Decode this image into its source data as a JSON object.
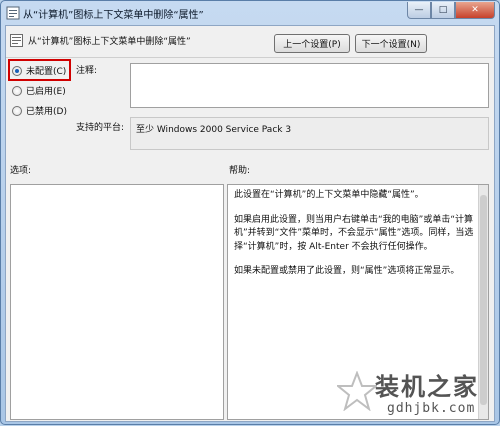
{
  "window": {
    "title": "从“计算机”图标上下文菜单中删除“属性”",
    "minimize_glyph": "—",
    "maximize_glyph": "□",
    "close_glyph": "✕"
  },
  "policy": {
    "icon": "policy-setting-icon",
    "title": "从“计算机”图标上下文菜单中删除“属性”"
  },
  "buttons": {
    "prev": "上一个设置(P)",
    "next": "下一个设置(N)"
  },
  "state": {
    "options": [
      {
        "label": "未配置(C)",
        "checked": true
      },
      {
        "label": "已启用(E)",
        "checked": false
      },
      {
        "label": "已禁用(D)",
        "checked": false
      }
    ]
  },
  "comment": {
    "label": "注释:",
    "value": ""
  },
  "platform": {
    "label": "支持的平台:",
    "value": "至少 Windows 2000 Service Pack 3"
  },
  "options_panel": {
    "label": "选项:"
  },
  "help_panel": {
    "label": "帮助:",
    "paragraphs": [
      "此设置在“计算机”的上下文菜单中隐藏“属性”。",
      "如果启用此设置，则当用户右键单击“我的电脑”或单击“计算机”并转到“文件”菜单时，不会显示“属性”选项。同样，当选择“计算机”时，按 Alt-Enter 不会执行任何操作。",
      "如果未配置或禁用了此设置，则“属性”选项将正常显示。"
    ]
  },
  "watermark": {
    "brand": "装机之家",
    "url": "gdhjbk.com"
  },
  "colors": {
    "highlight": "#d00000",
    "radio_dot": "#1b5fb6"
  }
}
